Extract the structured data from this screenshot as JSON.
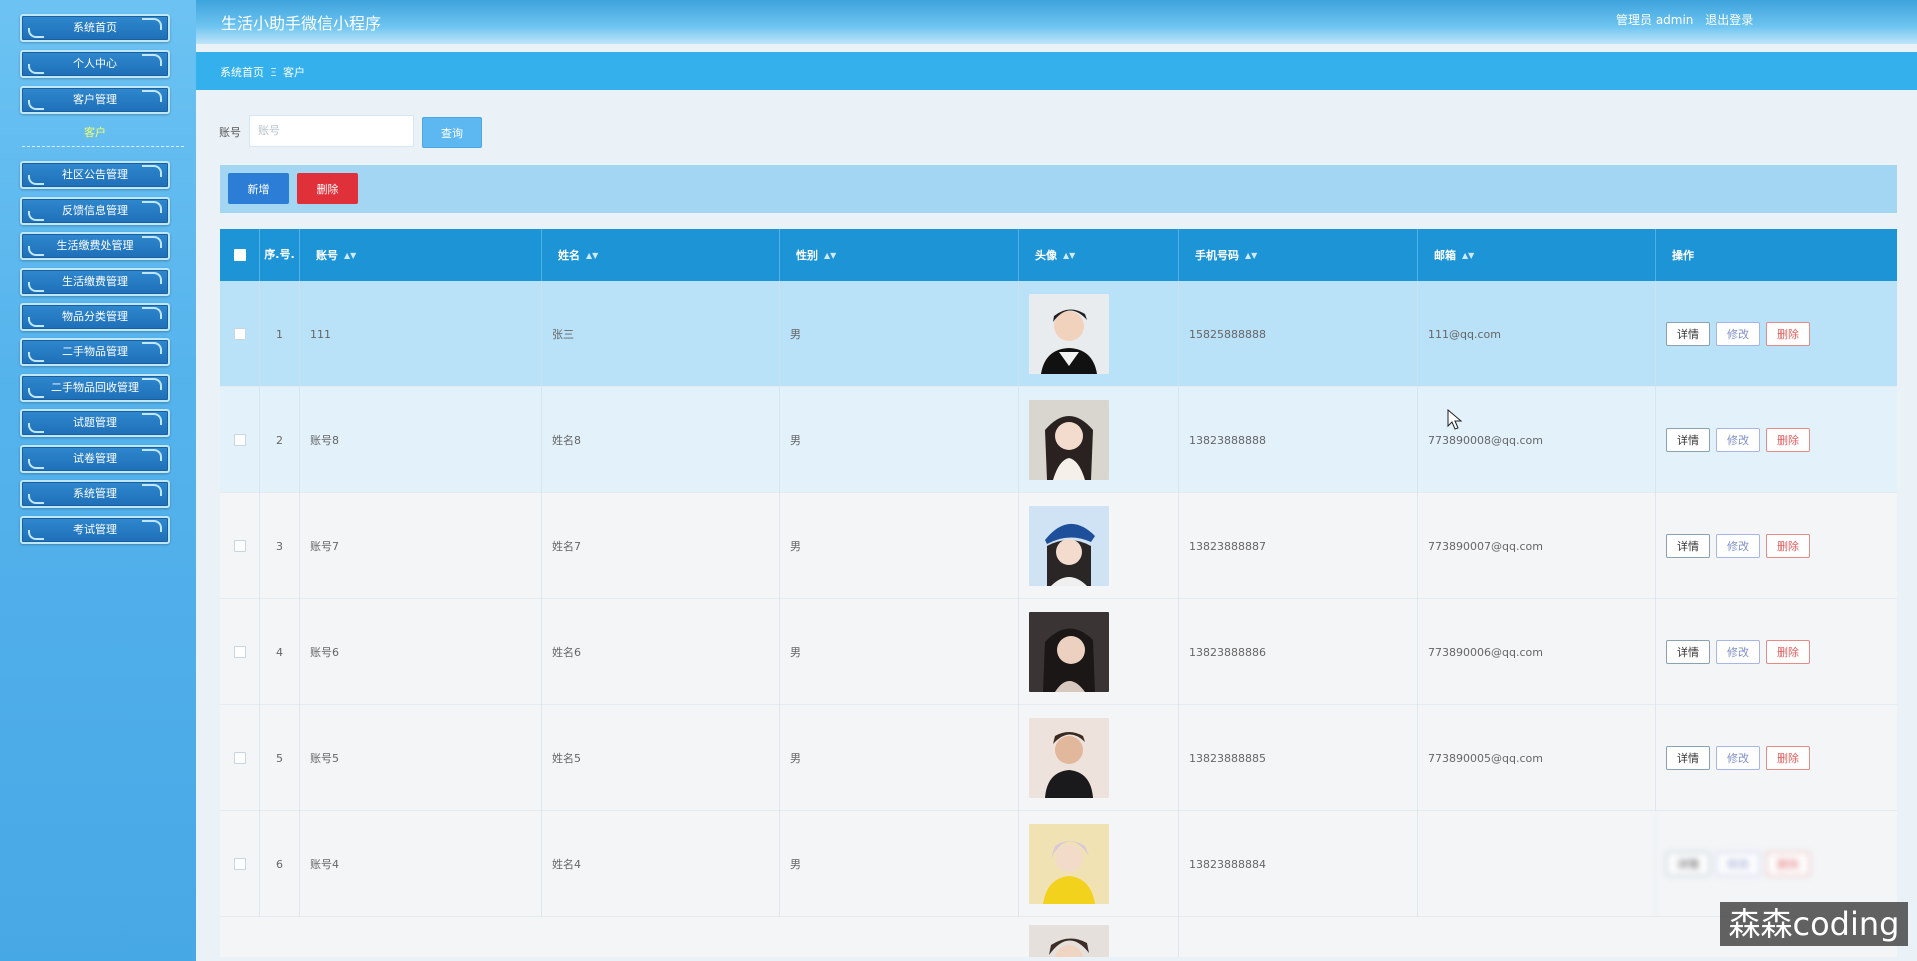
{
  "app": {
    "title": "生活小助手微信小程序"
  },
  "header": {
    "user_label": "管理员 admin",
    "logout_label": "退出登录"
  },
  "sidebar": {
    "items": [
      {
        "label": "系统首页"
      },
      {
        "label": "个人中心"
      },
      {
        "label": "客户管理"
      },
      {
        "label": "社区公告管理"
      },
      {
        "label": "反馈信息管理"
      },
      {
        "label": "生活缴费处管理"
      },
      {
        "label": "生活缴费管理"
      },
      {
        "label": "物品分类管理"
      },
      {
        "label": "二手物品管理"
      },
      {
        "label": "二手物品回收管理"
      },
      {
        "label": "试题管理"
      },
      {
        "label": "试卷管理"
      },
      {
        "label": "系统管理"
      },
      {
        "label": "考试管理"
      }
    ],
    "active_sub": "客户"
  },
  "breadcrumb": {
    "home": "系统首页",
    "separator": "Ξ",
    "current": "客户"
  },
  "search": {
    "label": "账号",
    "placeholder": "账号",
    "value": "",
    "button": "查询"
  },
  "actions": {
    "add": "新增",
    "delete": "删除"
  },
  "table": {
    "headers": {
      "seq": "序.号.",
      "account": "账号",
      "name": "姓名",
      "gender": "性别",
      "avatar": "头像",
      "phone": "手机号码",
      "email": "邮箱",
      "ops": "操作"
    },
    "op_labels": {
      "detail": "详情",
      "edit": "修改",
      "remove": "删除"
    },
    "rows": [
      {
        "seq": "1",
        "account": "111",
        "name": "张三",
        "gender": "男",
        "phone": "15825888888",
        "email": "111@qq.com"
      },
      {
        "seq": "2",
        "account": "账号8",
        "name": "姓名8",
        "gender": "男",
        "phone": "13823888888",
        "email": "773890008@qq.com"
      },
      {
        "seq": "3",
        "account": "账号7",
        "name": "姓名7",
        "gender": "男",
        "phone": "13823888887",
        "email": "773890007@qq.com"
      },
      {
        "seq": "4",
        "account": "账号6",
        "name": "姓名6",
        "gender": "男",
        "phone": "13823888886",
        "email": "773890006@qq.com"
      },
      {
        "seq": "5",
        "account": "账号5",
        "name": "姓名5",
        "gender": "男",
        "phone": "13823888885",
        "email": "773890005@qq.com"
      },
      {
        "seq": "6",
        "account": "账号4",
        "name": "姓名4",
        "gender": "男",
        "phone": "13823888884",
        "email": ""
      }
    ]
  },
  "watermark": "森森coding",
  "colors": {
    "sidebar": "#55b3ec",
    "header": "#3ea3dd",
    "table_head": "#1d94d6",
    "add_btn": "#2b7dd6",
    "del_btn": "#e0313b",
    "active_sub": "#f4ff6a"
  }
}
